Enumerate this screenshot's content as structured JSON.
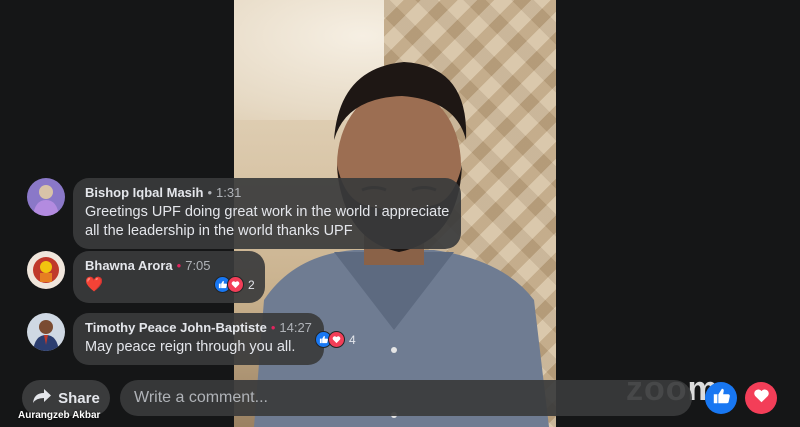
{
  "video": {
    "speaker_name": "Aurangzeb Akbar",
    "watermark": "zoom"
  },
  "comments": [
    {
      "author": "Bishop Iqbal Masih",
      "separator": "•",
      "time": "1:31",
      "lines": [
        "Greetings UPF doing great work in the world i appreciate",
        "all the leadership in the world thanks UPF"
      ]
    },
    {
      "author": "Bhawna Arora",
      "separator": "•",
      "time": "7:05",
      "text": "❤️",
      "reaction_count": "2"
    },
    {
      "author": "Timothy Peace John-Baptiste",
      "separator": "•",
      "time": "14:27",
      "text": "May peace reign through you all.",
      "reaction_count": "4"
    }
  ],
  "bottom_bar": {
    "share_label": "Share",
    "comment_placeholder": "Write a comment..."
  },
  "colors": {
    "like_blue": "#1877f2",
    "love_red": "#f33e58",
    "bubble_bg": "#3a3b3c"
  }
}
